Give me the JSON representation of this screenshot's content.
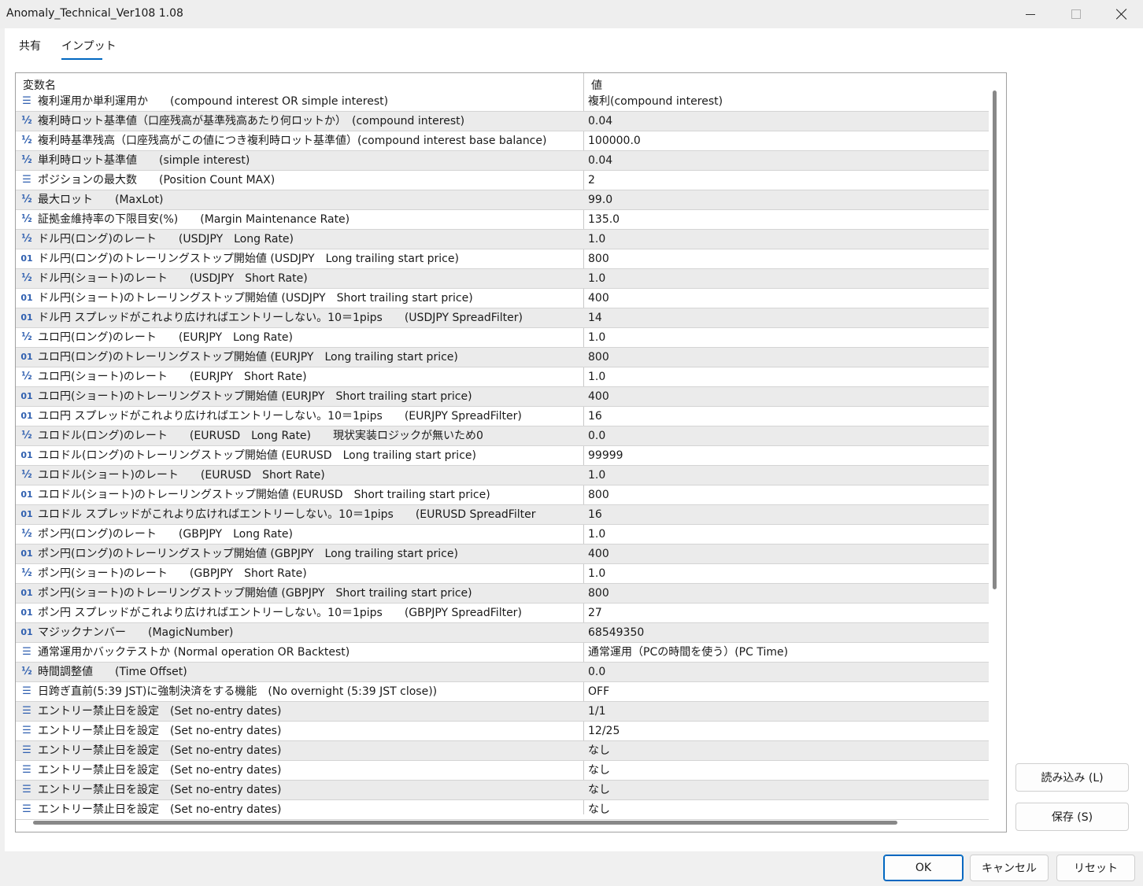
{
  "window": {
    "title": "Anomaly_Technical_Ver108 1.08"
  },
  "tabs": [
    {
      "label": "共有",
      "active": false
    },
    {
      "label": "インプット",
      "active": true
    }
  ],
  "grid": {
    "headers": {
      "name": "変数名",
      "value": "値"
    },
    "rows": [
      {
        "type": "enum",
        "name": "複利運用か単利運用か　　(compound interest OR simple interest)",
        "value": "複利(compound interest)"
      },
      {
        "type": "double",
        "name": "複利時ロット基準値（口座残高が基準残高あたり何ロットか）　(compound interest)",
        "value": "0.04"
      },
      {
        "type": "double",
        "name": "複利時基準残高（口座残高がこの値につき複利時ロット基準値）(compound interest base balance)",
        "value": "100000.0"
      },
      {
        "type": "double",
        "name": "単利時ロット基準値　　(simple interest)",
        "value": "0.04"
      },
      {
        "type": "enum",
        "name": "ポジションの最大数　　(Position Count MAX)",
        "value": "2"
      },
      {
        "type": "double",
        "name": "最大ロット　　(MaxLot)",
        "value": "99.0"
      },
      {
        "type": "double",
        "name": "証拠金維持率の下限目安(%)　　(Margin Maintenance Rate)",
        "value": "135.0"
      },
      {
        "type": "double",
        "name": "ドル円(ロング)のレート　　(USDJPY　Long Rate)",
        "value": "1.0"
      },
      {
        "type": "int",
        "name": "ドル円(ロング)のトレーリングストップ開始値 (USDJPY　Long trailing start price)",
        "value": "800"
      },
      {
        "type": "double",
        "name": "ドル円(ショート)のレート　　(USDJPY　Short Rate)",
        "value": "1.0"
      },
      {
        "type": "int",
        "name": "ドル円(ショート)のトレーリングストップ開始値 (USDJPY　Short trailing start price)",
        "value": "400"
      },
      {
        "type": "int",
        "name": "ドル円 スプレッドがこれより広ければエントリーしない。10＝1pips　　(USDJPY SpreadFilter)",
        "value": "14"
      },
      {
        "type": "double",
        "name": "ユロ円(ロング)のレート　　(EURJPY　Long Rate)",
        "value": "1.0"
      },
      {
        "type": "int",
        "name": "ユロ円(ロング)のトレーリングストップ開始値 (EURJPY　Long trailing start price)",
        "value": "800"
      },
      {
        "type": "double",
        "name": "ユロ円(ショート)のレート　　(EURJPY　Short Rate)",
        "value": "1.0"
      },
      {
        "type": "int",
        "name": "ユロ円(ショート)のトレーリングストップ開始値 (EURJPY　Short trailing start price)",
        "value": "400"
      },
      {
        "type": "int",
        "name": "ユロ円 スプレッドがこれより広ければエントリーしない。10＝1pips　　(EURJPY SpreadFilter)",
        "value": "16"
      },
      {
        "type": "double",
        "name": "ユロドル(ロング)のレート　　(EURUSD　Long Rate)　　現状実装ロジックが無いため0",
        "value": "0.0"
      },
      {
        "type": "int",
        "name": "ユロドル(ロング)のトレーリングストップ開始値 (EURUSD　Long trailing start price)",
        "value": "99999"
      },
      {
        "type": "double",
        "name": "ユロドル(ショート)のレート　　(EURUSD　Short Rate)",
        "value": "1.0"
      },
      {
        "type": "int",
        "name": "ユロドル(ショート)のトレーリングストップ開始値 (EURUSD　Short trailing start price)",
        "value": "800"
      },
      {
        "type": "int",
        "name": "ユロドル スプレッドがこれより広ければエントリーしない。10＝1pips　　(EURUSD SpreadFilter",
        "value": "16"
      },
      {
        "type": "double",
        "name": "ポン円(ロング)のレート　　(GBPJPY　Long Rate)",
        "value": "1.0"
      },
      {
        "type": "int",
        "name": "ポン円(ロング)のトレーリングストップ開始値 (GBPJPY　Long trailing start price)",
        "value": "400"
      },
      {
        "type": "double",
        "name": "ポン円(ショート)のレート　　(GBPJPY　Short Rate)",
        "value": "1.0"
      },
      {
        "type": "int",
        "name": "ポン円(ショート)のトレーリングストップ開始値 (GBPJPY　Short trailing start price)",
        "value": "800"
      },
      {
        "type": "int",
        "name": "ポン円 スプレッドがこれより広ければエントリーしない。10＝1pips　　(GBPJPY SpreadFilter)",
        "value": "27"
      },
      {
        "type": "int",
        "name": "マジックナンバー　　(MagicNumber)",
        "value": "68549350"
      },
      {
        "type": "enum",
        "name": "通常運用かバックテストか (Normal operation OR Backtest)",
        "value": "通常運用（PCの時間を使う）(PC Time)"
      },
      {
        "type": "double",
        "name": "時間調整値　　(Time Offset)",
        "value": "0.0"
      },
      {
        "type": "enum",
        "name": "日跨ぎ直前(5:39 JST)に強制決済をする機能　(No overnight (5:39 JST close))",
        "value": "OFF"
      },
      {
        "type": "enum",
        "name": "エントリー禁止日を設定　(Set no-entry dates)",
        "value": "1/1"
      },
      {
        "type": "enum",
        "name": "エントリー禁止日を設定　(Set no-entry dates)",
        "value": "12/25"
      },
      {
        "type": "enum",
        "name": "エントリー禁止日を設定　(Set no-entry dates)",
        "value": "なし"
      },
      {
        "type": "enum",
        "name": "エントリー禁止日を設定　(Set no-entry dates)",
        "value": "なし"
      },
      {
        "type": "enum",
        "name": "エントリー禁止日を設定　(Set no-entry dates)",
        "value": "なし"
      },
      {
        "type": "enum",
        "name": "エントリー禁止日を設定　(Set no-entry dates)",
        "value": "なし"
      }
    ]
  },
  "type_icons": {
    "enum": "list-enum-icon",
    "double": "double-type-icon",
    "int": "integer-type-icon"
  },
  "icon_glyphs": {
    "enum": "☰",
    "double": "½",
    "int": "01"
  },
  "buttons": {
    "load": "読み込み (L)",
    "save": "保存 (S)",
    "ok": "OK",
    "cancel": "キャンセル",
    "reset": "リセット"
  },
  "colors": {
    "accent": "#0067c0",
    "icon": "#3060b0",
    "row_alt": "#ebebeb"
  }
}
